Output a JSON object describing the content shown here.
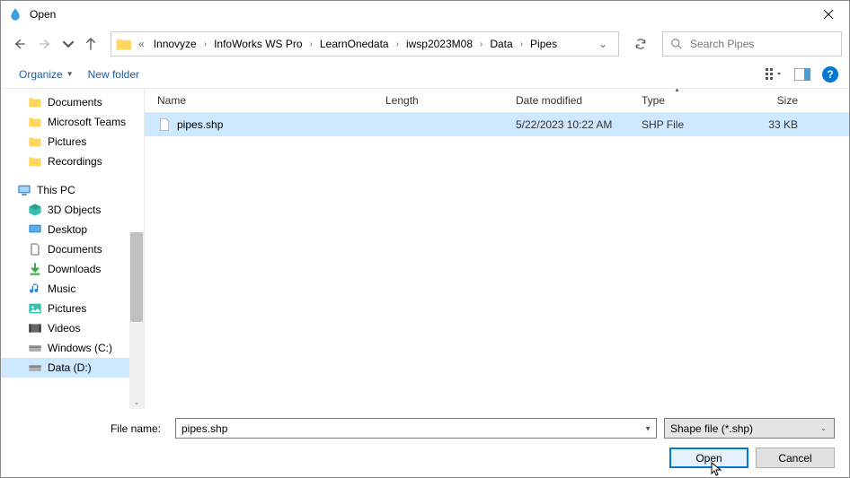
{
  "title": "Open",
  "breadcrumbs": [
    "Innovyze",
    "InfoWorks WS Pro",
    "LearnOnedata",
    "iwsp2023M08",
    "Data",
    "Pipes"
  ],
  "search": {
    "placeholder": "Search Pipes"
  },
  "toolbar": {
    "organize": "Organize",
    "newfolder": "New folder"
  },
  "sidebar": {
    "quick": [
      {
        "label": "Documents",
        "icon": "folder"
      },
      {
        "label": "Microsoft Teams",
        "icon": "folder"
      },
      {
        "label": "Pictures",
        "icon": "folder"
      },
      {
        "label": "Recordings",
        "icon": "folder"
      }
    ],
    "thispc_label": "This PC",
    "thispc": [
      {
        "label": "3D Objects",
        "icon": "3d"
      },
      {
        "label": "Desktop",
        "icon": "desktop"
      },
      {
        "label": "Documents",
        "icon": "documents"
      },
      {
        "label": "Downloads",
        "icon": "downloads"
      },
      {
        "label": "Music",
        "icon": "music"
      },
      {
        "label": "Pictures",
        "icon": "pictures"
      },
      {
        "label": "Videos",
        "icon": "videos"
      },
      {
        "label": "Windows (C:)",
        "icon": "drive"
      },
      {
        "label": "Data (D:)",
        "icon": "drive",
        "selected": true
      }
    ]
  },
  "columns": {
    "name": "Name",
    "length": "Length",
    "date": "Date modified",
    "type": "Type",
    "size": "Size"
  },
  "files": [
    {
      "name": "pipes.shp",
      "length": "",
      "date": "5/22/2023 10:22 AM",
      "type": "SHP File",
      "size": "33 KB",
      "selected": true
    }
  ],
  "footer": {
    "filename_label": "File name:",
    "filename_value": "pipes.shp",
    "filetype": "Shape file (*.shp)",
    "open": "Open",
    "cancel": "Cancel"
  }
}
